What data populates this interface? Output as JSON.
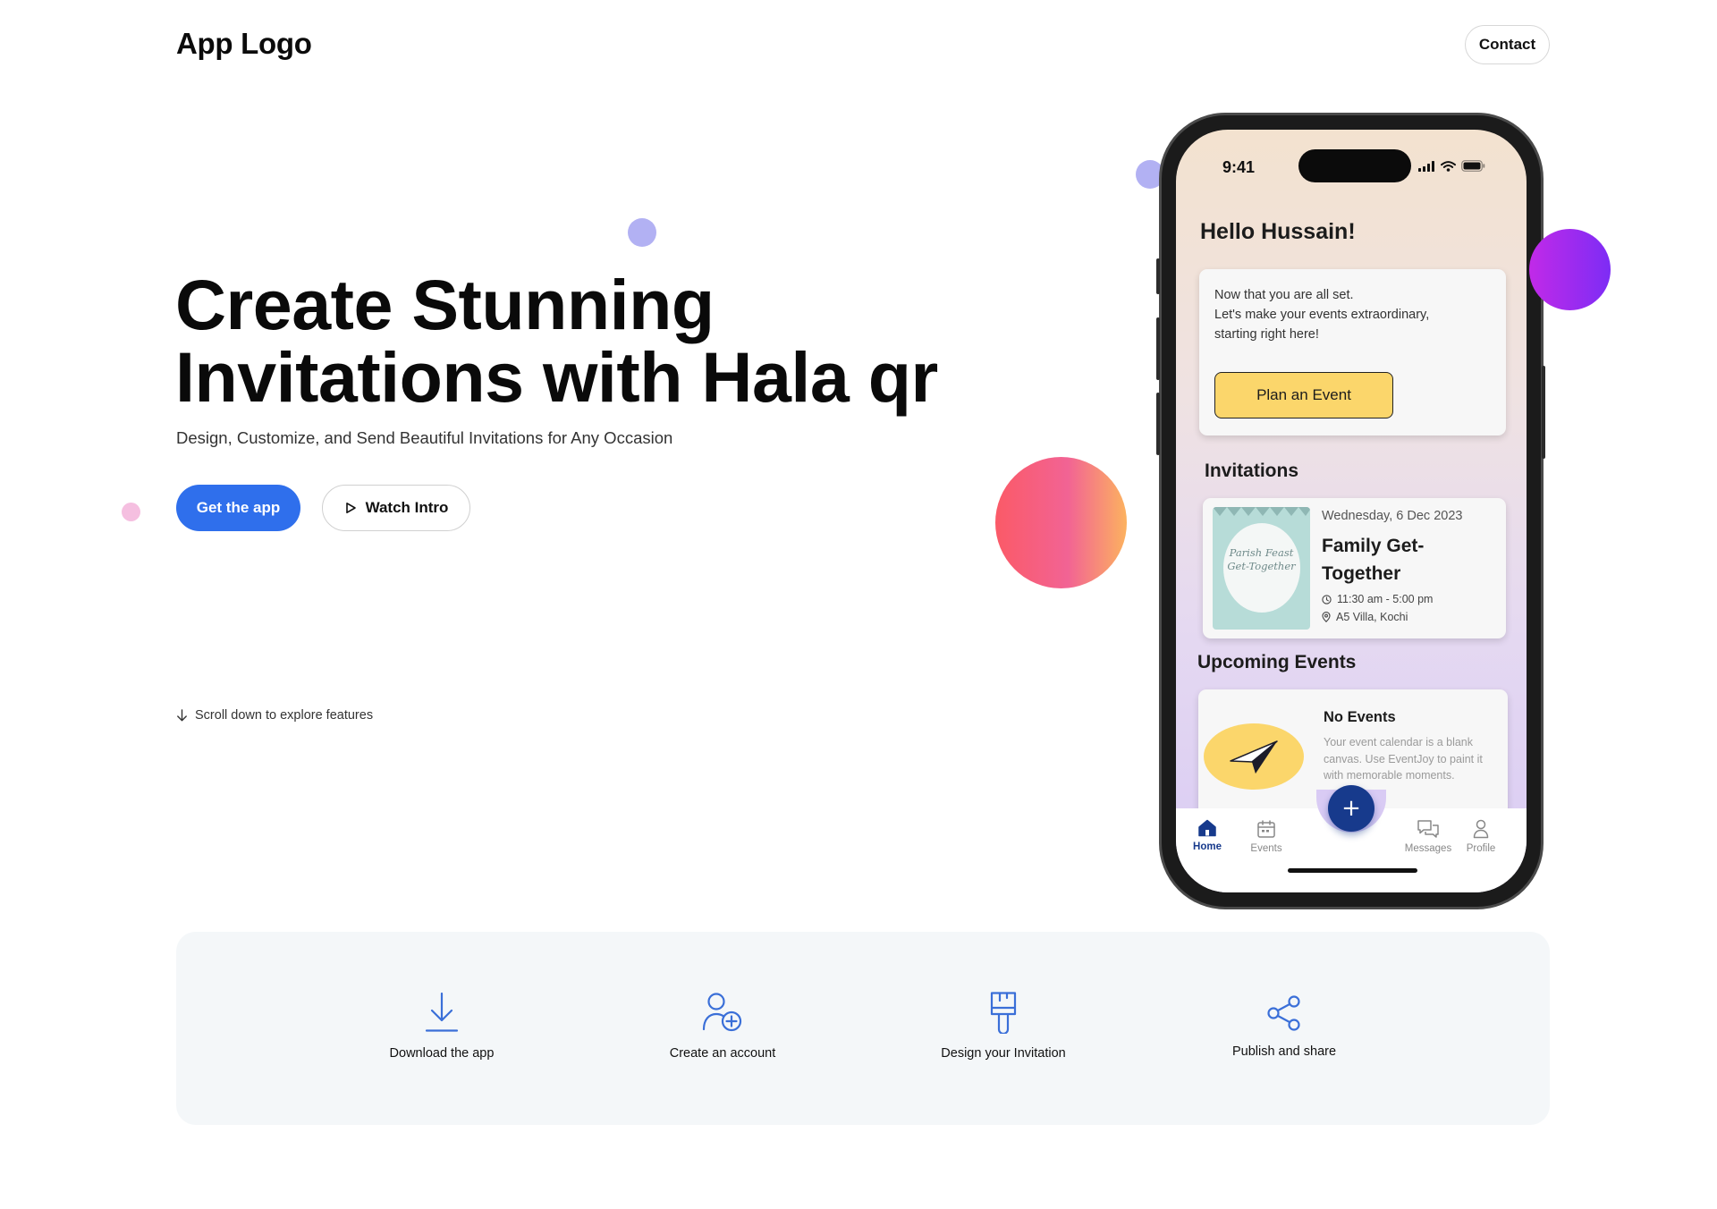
{
  "header": {
    "logo": "App Logo",
    "contact_label": "Contact"
  },
  "hero": {
    "title_line1": "Create Stunning",
    "title_line2": "Invitations with Hala qr",
    "subtitle": "Design, Customize, and Send Beautiful Invitations for Any Occasion",
    "primary_button": "Get the app",
    "secondary_button": "Watch Intro",
    "scroll_hint": "Scroll down to explore features"
  },
  "phone": {
    "status_time": "9:41",
    "greeting": "Hello Hussain!",
    "welcome": {
      "line1": "Now that you are all set.",
      "line2": "Let's make your events extraordinary,",
      "line3": "starting right here!",
      "button": "Plan an Event"
    },
    "invitations": {
      "title": "Invitations",
      "item": {
        "date": "Wednesday, 6 Dec 2023",
        "name": "Family Get-Together",
        "time": "11:30 am - 5:00 pm",
        "location": "A5 Villa, Kochi",
        "thumb_text_line1": "Parish Feast",
        "thumb_text_line2": "Get-Together"
      }
    },
    "upcoming": {
      "title": "Upcoming Events",
      "empty_title": "No Events",
      "empty_text": "Your event calendar is a blank canvas. Use EventJoy to paint it with memorable moments."
    },
    "tabs": [
      {
        "label": "Home",
        "icon": "home-icon",
        "active": true
      },
      {
        "label": "Events",
        "icon": "calendar-icon",
        "active": false
      },
      {
        "label": "Messages",
        "icon": "messages-icon",
        "active": false
      },
      {
        "label": "Profile",
        "icon": "profile-icon",
        "active": false
      }
    ],
    "fab_label": "+"
  },
  "steps": [
    {
      "label": "Download the app",
      "icon": "download-icon"
    },
    {
      "label": "Create an account",
      "icon": "user-add-icon"
    },
    {
      "label": "Design your Invitation",
      "icon": "paintbrush-icon"
    },
    {
      "label": "Publish and share",
      "icon": "share-icon"
    }
  ],
  "colors": {
    "primary": "#2f6fec",
    "navy": "#173a8c",
    "yellow": "#fbd66b",
    "step_icon": "#3a6fd8",
    "panel_bg": "#f4f7f9"
  }
}
